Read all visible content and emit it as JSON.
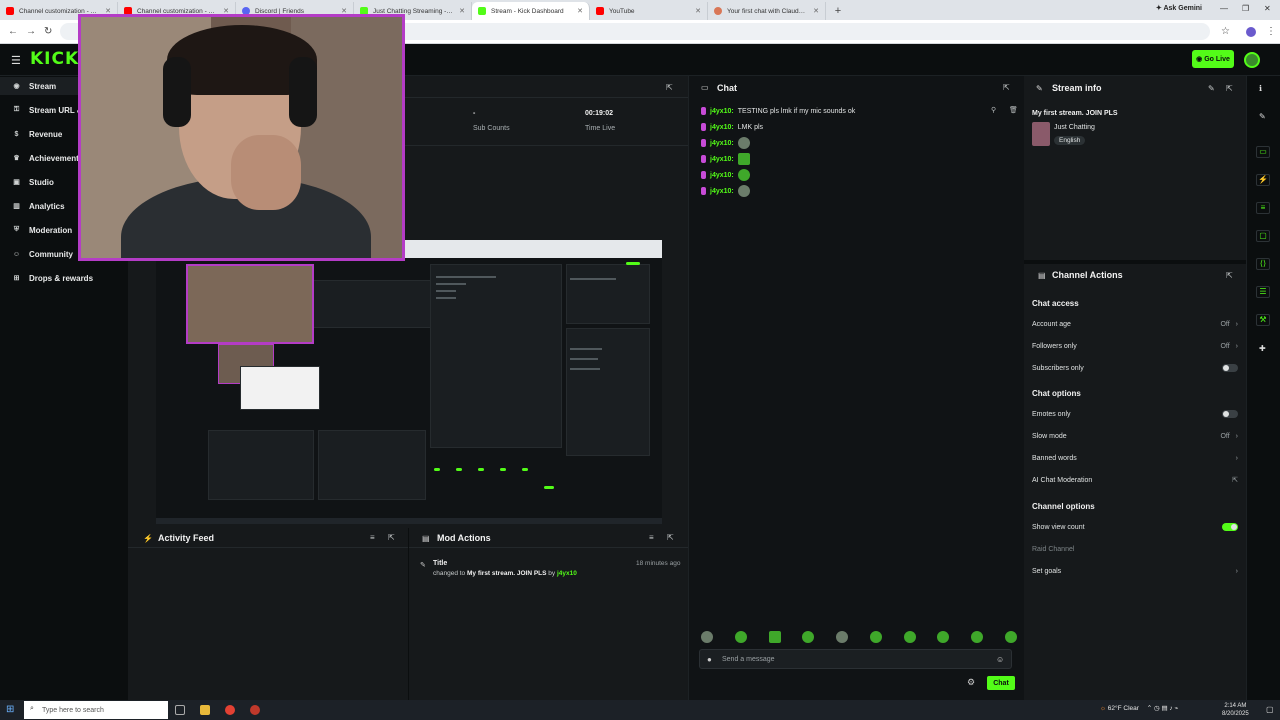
{
  "browser": {
    "tabs": [
      {
        "title": "Channel customization - YouTu",
        "color": "#ff0000"
      },
      {
        "title": "Channel customization - YouTu",
        "color": "#ff0000"
      },
      {
        "title": "Discord | Friends",
        "color": "#5865f2"
      },
      {
        "title": "Just Chatting Streaming - Live",
        "color": "#53fc18"
      },
      {
        "title": "Stream - Kick Dashboard",
        "color": "#53fc18"
      },
      {
        "title": "YouTube",
        "color": "#ff0000"
      },
      {
        "title": "Your first chat with Claude - Cl",
        "color": "#d97757"
      }
    ],
    "ask_gemini": "Ask Gemini"
  },
  "kick": {
    "logo": "KICK",
    "go_live": "Go Live",
    "accent": "#53fc18"
  },
  "sidebar": {
    "items": [
      {
        "label": "Stream",
        "icon": "broadcast-icon"
      },
      {
        "label": "Stream URL &",
        "icon": "key-icon"
      },
      {
        "label": "Revenue",
        "icon": "dollar-icon"
      },
      {
        "label": "Achievement",
        "icon": "trophy-icon"
      },
      {
        "label": "Studio",
        "icon": "studio-icon"
      },
      {
        "label": "Analytics",
        "icon": "chart-icon"
      },
      {
        "label": "Moderation",
        "icon": "shield-icon"
      },
      {
        "label": "Community",
        "icon": "users-icon"
      },
      {
        "label": "Drops & rewards",
        "icon": "gift-icon"
      }
    ]
  },
  "stream_panel": {
    "stats": [
      {
        "value": "-",
        "label": "Sub Counts"
      },
      {
        "value": "00:19:02",
        "label": "Time Live"
      }
    ]
  },
  "chat": {
    "title": "Chat",
    "username": "j4yx10:",
    "messages": [
      {
        "text": "TESTING pls lmk if my mic sounds ok"
      },
      {
        "text": "LMK pls"
      },
      {
        "text": ""
      },
      {
        "text": ""
      },
      {
        "text": ""
      },
      {
        "text": ""
      }
    ],
    "placeholder": "Send a message",
    "send_label": "Chat"
  },
  "stream_info": {
    "header": "Stream info",
    "title": "My first stream. JOIN PLS",
    "category": "Just Chatting",
    "language": "English"
  },
  "channel_actions": {
    "header": "Channel Actions",
    "chat_access": "Chat access",
    "account_age": {
      "label": "Account age",
      "value": "Off"
    },
    "followers_only": {
      "label": "Followers only",
      "value": "Off"
    },
    "subscribers_only": {
      "label": "Subscribers only"
    },
    "chat_options": "Chat options",
    "emotes_only": {
      "label": "Emotes only"
    },
    "slow_mode": {
      "label": "Slow mode",
      "value": "Off"
    },
    "banned_words": {
      "label": "Banned words"
    },
    "ai_chat_moderation": {
      "label": "AI Chat Moderation"
    },
    "channel_options": "Channel options",
    "show_view_count": {
      "label": "Show view count",
      "on": true
    },
    "raid_channel": {
      "label": "Raid Channel"
    },
    "set_goals": {
      "label": "Set goals"
    }
  },
  "activity_feed": {
    "title": "Activity Feed"
  },
  "mod_actions": {
    "title": "Mod Actions",
    "entry": {
      "title": "Title",
      "time": "18 minutes ago",
      "changed_to": "changed to",
      "new_title": "My first stream. JOIN PLS",
      "by": "by",
      "user": "j4yx10"
    }
  },
  "taskbar": {
    "search": "Type here to search",
    "weather": "62°F  Clear",
    "time": "2:14 AM",
    "date": "8/20/2025"
  }
}
